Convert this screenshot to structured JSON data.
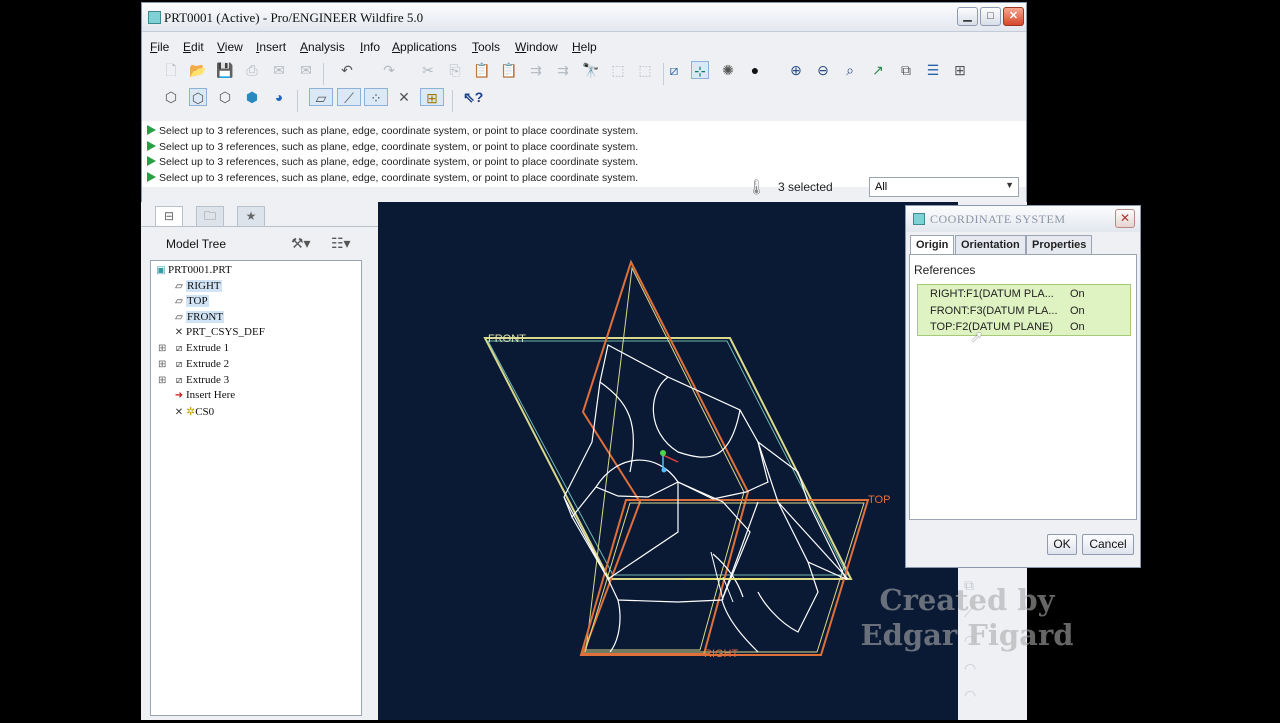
{
  "window": {
    "title": "PRT0001 (Active) - Pro/ENGINEER Wildfire 5.0",
    "controls": [
      "minimize-icon",
      "maximize-icon",
      "close-icon"
    ]
  },
  "menu": [
    "File",
    "Edit",
    "View",
    "Insert",
    "Analysis",
    "Info",
    "Applications",
    "Tools",
    "Window",
    "Help"
  ],
  "messages": [
    "Select up to 3 references, such as plane, edge, coordinate system, or point to place coordinate system.",
    "Select up to 3 references, such as plane, edge, coordinate system, or point to place coordinate system.",
    "Select up to 3 references, such as plane, edge, coordinate system, or point to place coordinate system.",
    "Select up to 3 references, such as plane, edge, coordinate system, or point to place coordinate system."
  ],
  "selection": {
    "count_text": "3 selected",
    "filter_value": "All"
  },
  "model_tree": {
    "title": "Model Tree",
    "items": [
      {
        "label": "PRT0001.PRT",
        "icon": "part-icon"
      },
      {
        "label": "RIGHT",
        "icon": "datum-plane-icon"
      },
      {
        "label": "TOP",
        "icon": "datum-plane-icon"
      },
      {
        "label": "FRONT",
        "icon": "datum-plane-icon"
      },
      {
        "label": "PRT_CSYS_DEF",
        "icon": "csys-icon"
      },
      {
        "label": "Extrude 1",
        "icon": "extrude-icon"
      },
      {
        "label": "Extrude 2",
        "icon": "extrude-icon"
      },
      {
        "label": "Extrude 3",
        "icon": "extrude-icon"
      },
      {
        "label": "Insert Here",
        "icon": "insert-arrow-icon"
      },
      {
        "label": "CS0",
        "icon": "csys-icon"
      }
    ]
  },
  "viewport": {
    "plane_labels": {
      "front": "FRONT",
      "top": "TOP",
      "right": "RIGHT"
    }
  },
  "dialog": {
    "title": "COORDINATE SYSTEM",
    "tabs": [
      "Origin",
      "Orientation",
      "Properties"
    ],
    "references_label": "References",
    "references": [
      {
        "name": "RIGHT:F1(DATUM PLA...",
        "state": "On"
      },
      {
        "name": "FRONT:F3(DATUM PLA...",
        "state": "On"
      },
      {
        "name": "TOP:F2(DATUM PLANE)",
        "state": "On"
      }
    ],
    "ok_label": "OK",
    "cancel_label": "Cancel"
  },
  "watermark": {
    "line1": "Created by",
    "line2": "Edgar Figard"
  },
  "colors": {
    "viewport_bg": "#0a1a35",
    "plane_yellow": "#d9d98a",
    "plane_red": "#e0703a",
    "geometry_white": "#ffffff",
    "reference_highlight": "#dff3c2"
  }
}
